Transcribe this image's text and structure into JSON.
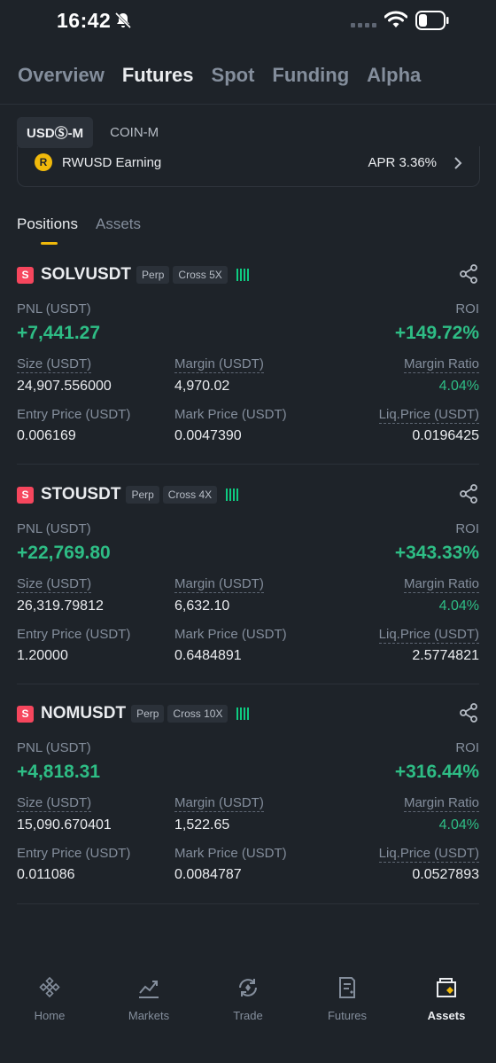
{
  "status": {
    "time": "16:42"
  },
  "top_tabs": [
    "Overview",
    "Futures",
    "Spot",
    "Funding",
    "Alpha"
  ],
  "sub_tabs": [
    "USDⓈ-M",
    "COIN-M"
  ],
  "earn": {
    "logo": "R",
    "label": "RWUSD Earning",
    "apr": "APR 3.36%"
  },
  "position_tabs": [
    "Positions",
    "Assets"
  ],
  "labels": {
    "pnl": "PNL (USDT)",
    "roi": "ROI",
    "size": "Size (USDT)",
    "margin": "Margin (USDT)",
    "margin_ratio": "Margin Ratio",
    "entry": "Entry Price (USDT)",
    "mark": "Mark Price (USDT)",
    "liq": "Liq.Price (USDT)",
    "perp": "Perp",
    "side": "S"
  },
  "positions": [
    {
      "symbol": "SOLVUSDT",
      "leverage": "Cross 5X",
      "pnl": "+7,441.27",
      "roi": "+149.72%",
      "size": "24,907.556000",
      "margin": "4,970.02",
      "margin_ratio": "4.04%",
      "entry": "0.006169",
      "mark": "0.0047390",
      "liq": "0.0196425"
    },
    {
      "symbol": "STOUSDT",
      "leverage": "Cross 4X",
      "pnl": "+22,769.80",
      "roi": "+343.33%",
      "size": "26,319.79812",
      "margin": "6,632.10",
      "margin_ratio": "4.04%",
      "entry": "1.20000",
      "mark": "0.6484891",
      "liq": "2.5774821"
    },
    {
      "symbol": "NOMUSDT",
      "leverage": "Cross 10X",
      "pnl": "+4,818.31",
      "roi": "+316.44%",
      "size": "15,090.670401",
      "margin": "1,522.65",
      "margin_ratio": "4.04%",
      "entry": "0.011086",
      "mark": "0.0084787",
      "liq": "0.0527893"
    }
  ],
  "bottom_nav": [
    {
      "label": "Home",
      "icon": "binance-logo-icon"
    },
    {
      "label": "Markets",
      "icon": "chart-icon"
    },
    {
      "label": "Trade",
      "icon": "trade-icon"
    },
    {
      "label": "Futures",
      "icon": "futures-icon"
    },
    {
      "label": "Assets",
      "icon": "wallet-icon"
    }
  ],
  "colors": {
    "background": "#1e2329",
    "positive": "#2ebd85",
    "accent": "#f0b90b",
    "short": "#f6465d"
  }
}
